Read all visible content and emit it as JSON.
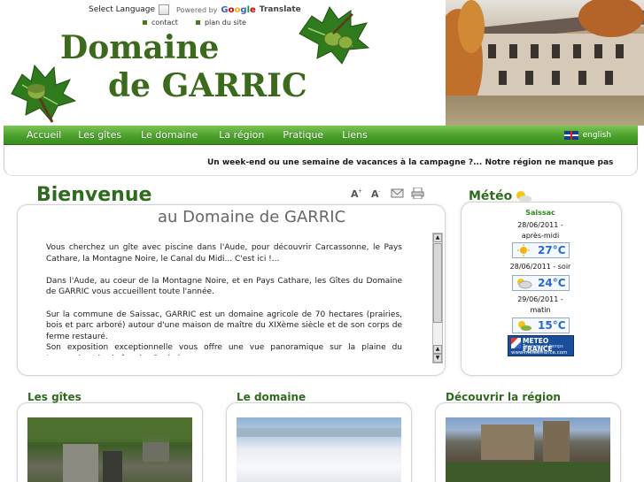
{
  "header": {
    "select_language": "Select Language",
    "powered_by": "Powered by",
    "google": "Google",
    "translate": "Translate",
    "links": [
      "contact",
      "plan du site"
    ],
    "logo_line1": "Domaine",
    "logo_line2": "de GARRIC"
  },
  "nav": {
    "items": [
      "Accueil",
      "Les gîtes",
      "Le domaine",
      "La région",
      "Pratique",
      "Liens"
    ],
    "english": "english"
  },
  "tagline": "Un week-end ou une semaine de vacances à la campagne ?... Notre région ne manque pas",
  "welcome": {
    "title": "Bienvenue",
    "subtitle": "au Domaine de GARRIC",
    "paragraphs": [
      "Vous cherchez un gîte avec piscine dans l'Aude, pour découvrir Carcassonne, le Pays Cathare, la Montagne Noire, le Canal du Midi... C'est ici !...",
      "Dans l'Aude, au coeur de la Montagne Noire, et en Pays Cathare, les Gîtes du Domaine de GARRIC vous accueillent toute l'année.",
      "Sur la commune de Saissac, GARRIC est un domaine agricole de 70 hectares (prairies, bois et parc arboré) autour d'une maison de maître du XIXème siècle et de son corps de ferme restauré.",
      "Son exposition exceptionnelle vous offre une vue panoramique sur la plaine du Lauragais et la chaîne des Pyrénées."
    ]
  },
  "meteo": {
    "title": "Météo",
    "city": "Saissac",
    "forecasts": [
      {
        "date": "28/06/2011 -",
        "period": "après-midi",
        "temp": "27°C",
        "icon": "sun-icon"
      },
      {
        "date": "28/06/2011 - soir",
        "period": "",
        "temp": "24°C",
        "icon": "partly-cloudy-icon"
      },
      {
        "date": "29/06/2011 -",
        "period": "matin",
        "temp": "15°C",
        "icon": "sun-cloud-icon"
      }
    ],
    "logo_name": "METEO FRANCE",
    "logo_tagline": "Toujours un temps d'avance",
    "logo_url": "www.meteofrance.com"
  },
  "sections": [
    {
      "title": "Les gîtes"
    },
    {
      "title": "Le domaine"
    },
    {
      "title": "Découvrir la région"
    }
  ],
  "colors": {
    "brand_green": "#2f6b1e",
    "nav_green": "#4aa12a",
    "temp_blue": "#2a6acc"
  }
}
